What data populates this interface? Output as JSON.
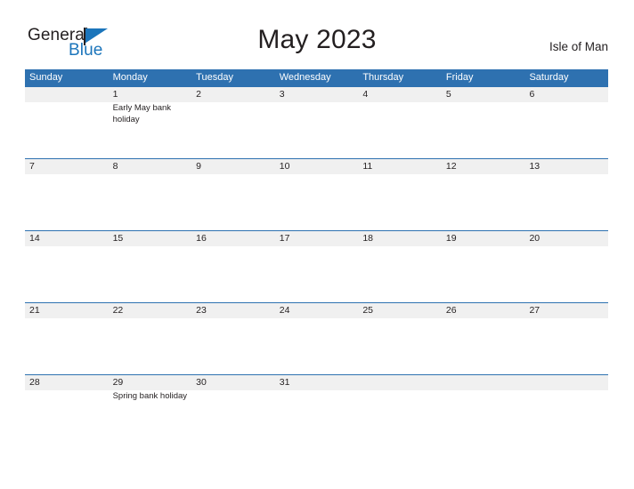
{
  "brand": {
    "name_part1": "General",
    "name_part2": "Blue",
    "flag_icon": "flag-triangle-icon",
    "color_dark": "#231f20",
    "color_blue": "#1b75bb"
  },
  "header": {
    "title": "May 2023",
    "location": "Isle of Man"
  },
  "theme": {
    "header_blue": "#2e71b0",
    "row_line_blue": "#2e71b0",
    "day_band_gray": "#f0f0f0",
    "text_dark": "#231f20",
    "background": "#ffffff"
  },
  "weekdays": [
    "Sunday",
    "Monday",
    "Tuesday",
    "Wednesday",
    "Thursday",
    "Friday",
    "Saturday"
  ],
  "weeks": [
    [
      {
        "date": "",
        "events": []
      },
      {
        "date": "1",
        "events": [
          "Early May bank holiday"
        ]
      },
      {
        "date": "2",
        "events": []
      },
      {
        "date": "3",
        "events": []
      },
      {
        "date": "4",
        "events": []
      },
      {
        "date": "5",
        "events": []
      },
      {
        "date": "6",
        "events": []
      }
    ],
    [
      {
        "date": "7",
        "events": []
      },
      {
        "date": "8",
        "events": []
      },
      {
        "date": "9",
        "events": []
      },
      {
        "date": "10",
        "events": []
      },
      {
        "date": "11",
        "events": []
      },
      {
        "date": "12",
        "events": []
      },
      {
        "date": "13",
        "events": []
      }
    ],
    [
      {
        "date": "14",
        "events": []
      },
      {
        "date": "15",
        "events": []
      },
      {
        "date": "16",
        "events": []
      },
      {
        "date": "17",
        "events": []
      },
      {
        "date": "18",
        "events": []
      },
      {
        "date": "19",
        "events": []
      },
      {
        "date": "20",
        "events": []
      }
    ],
    [
      {
        "date": "21",
        "events": []
      },
      {
        "date": "22",
        "events": []
      },
      {
        "date": "23",
        "events": []
      },
      {
        "date": "24",
        "events": []
      },
      {
        "date": "25",
        "events": []
      },
      {
        "date": "26",
        "events": []
      },
      {
        "date": "27",
        "events": []
      }
    ],
    [
      {
        "date": "28",
        "events": []
      },
      {
        "date": "29",
        "events": [
          "Spring bank holiday"
        ]
      },
      {
        "date": "30",
        "events": []
      },
      {
        "date": "31",
        "events": []
      },
      {
        "date": "",
        "events": []
      },
      {
        "date": "",
        "events": []
      },
      {
        "date": "",
        "events": []
      }
    ]
  ]
}
